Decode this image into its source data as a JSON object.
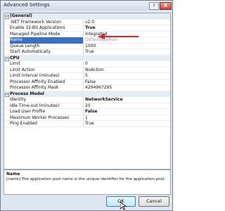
{
  "window": {
    "title": "Advanced Settings",
    "help_label": "?",
    "close_label": "X"
  },
  "grid": {
    "general": {
      "title": "(General)",
      "toggle": "−",
      "framework_name": ".NET Framework Version",
      "framework_val": "v2.0",
      "enable32_name": "Enable 32-Bit Applications",
      "enable32_val": "True",
      "pipeline_name": "Managed Pipeline Mode",
      "pipeline_val": "Integrated",
      "name_name": "Name",
      "name_val": "DefaultAppPool",
      "queue_name": "Queue Length",
      "queue_val": "1000",
      "start_name": "Start Automatically",
      "start_val": "True"
    },
    "cpu": {
      "title": "CPU",
      "toggle": "−",
      "limit_name": "Limit",
      "limit_val": "0",
      "action_name": "Limit Action",
      "action_val": "NoAction",
      "interval_name": "Limit Interval (minutes)",
      "interval_val": "5",
      "affinity_name": "Processor Affinity Enabled",
      "affinity_val": "False",
      "mask_name": "Processor Affinity Mask",
      "mask_val": "4294967295"
    },
    "process": {
      "title": "Process Model",
      "toggle": "−",
      "identity_name": "Identity",
      "identity_val": "NetworkService",
      "idle_name": "Idle Time-out (minutes)",
      "idle_val": "20",
      "load_name": "Load User Profile",
      "load_val": "False",
      "maxproc_name": "Maximum Worker Processes",
      "maxproc_val": "1",
      "ping_name": "Ping Enabled",
      "ping_val": "True"
    }
  },
  "description": {
    "title": "Name",
    "text": "[name] The application pool name is the unique identifier for the application pool."
  },
  "buttons": {
    "ok": "OK",
    "cancel": "Cancel"
  },
  "colors": {
    "accent": "#3a6fc5",
    "arrow": "#d8232a"
  }
}
